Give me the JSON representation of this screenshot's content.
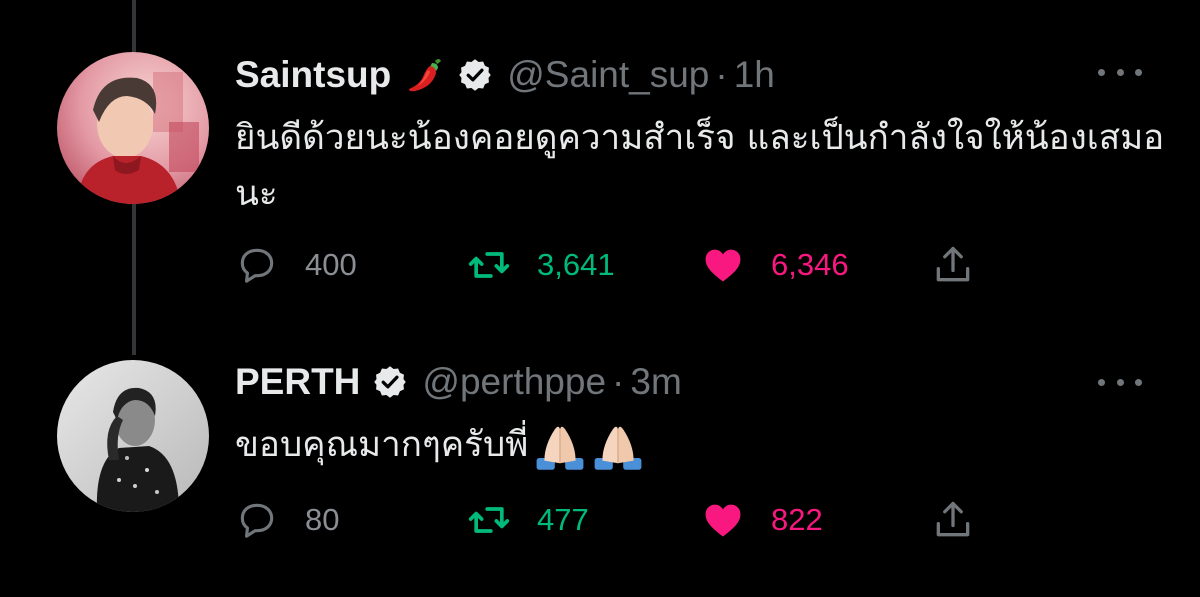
{
  "colors": {
    "background": "#000000",
    "text_primary": "#e7e9ea",
    "text_secondary": "#71767b",
    "retweet_green": "#00ba7c",
    "like_pink": "#f91880"
  },
  "tweets": [
    {
      "display_name": "Saintsup",
      "name_emoji": "hot-pepper-icon",
      "verified": true,
      "handle": "@Saint_sup",
      "separator": "·",
      "time": "1h",
      "text": "ยินดีด้วยนะน้องคอยดูความสำเร็จ และเป็นกำลังใจให้น้องเสมอนะ",
      "replies": "400",
      "retweets": "3,641",
      "likes": "6,346",
      "liked": true
    },
    {
      "display_name": "PERTH",
      "verified": true,
      "handle": "@perthppe",
      "separator": "·",
      "time": "3m",
      "text": "ขอบคุณมากๆครับพี่",
      "text_emoji": [
        "folded-hands-icon",
        "folded-hands-icon"
      ],
      "replies": "80",
      "retweets": "477",
      "likes": "822",
      "liked": true
    }
  ]
}
